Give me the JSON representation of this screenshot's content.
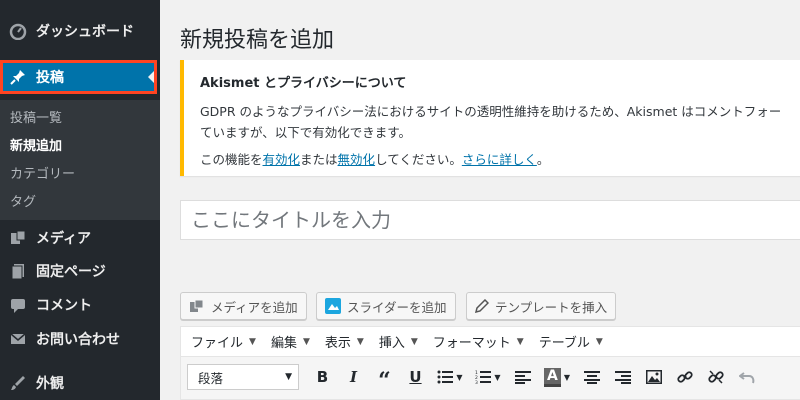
{
  "sidebar": {
    "dashboard": "ダッシュボード",
    "posts": "投稿",
    "submenu": [
      "投稿一覧",
      "新規追加",
      "カテゴリー",
      "タグ"
    ],
    "media": "メディア",
    "pages": "固定ページ",
    "comments": "コメント",
    "contact": "お問い合わせ",
    "appearance": "外観"
  },
  "page": {
    "title": "新規投稿を追加"
  },
  "notice": {
    "title": "Akismet とプライバシーについて",
    "body_line1": "GDPR のようなプライバシー法におけるサイトの透明性維持を助けるため、Akismet はコメントフォー",
    "body_line2": "ていますが、以下で有効化できます。",
    "links_prefix": "この機能を",
    "enable_link": "有効化",
    "links_mid": "または",
    "disable_link": "無効化",
    "links_mid2": "してください。",
    "more_link": "さらに詳しく",
    "links_suffix": "。"
  },
  "editor": {
    "title_placeholder": "ここにタイトルを入力",
    "add_media": "メディアを追加",
    "add_slider": "スライダーを追加",
    "insert_template": "テンプレートを挿入",
    "menus": [
      "ファイル",
      "編集",
      "表示",
      "挿入",
      "フォーマット",
      "テーブル"
    ],
    "format_select": "段落"
  },
  "colors": {
    "sidebar_bg": "#23282d",
    "active_bg": "#0073aa",
    "highlight": "#ff4422",
    "notice_border": "#ffb900",
    "link": "#0073aa"
  }
}
